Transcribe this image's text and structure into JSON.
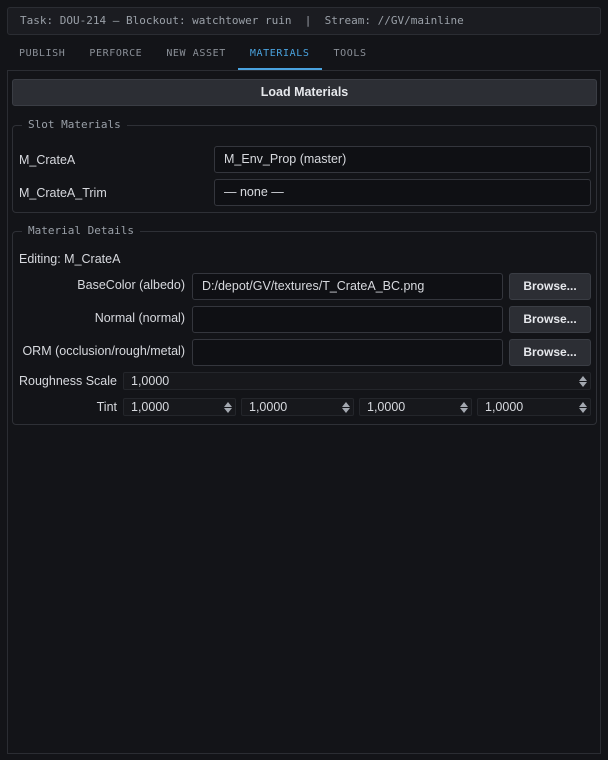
{
  "task_bar": {
    "text": "Task: DOU-214 — Blockout: watchtower ruin  |  Stream: //GV/mainline"
  },
  "tabs": [
    {
      "label": "PUBLISH",
      "active": false
    },
    {
      "label": "PERFORCE",
      "active": false
    },
    {
      "label": "NEW ASSET",
      "active": false
    },
    {
      "label": "MATERIALS",
      "active": true
    },
    {
      "label": "TOOLS",
      "active": false
    }
  ],
  "load_button": "Load Materials",
  "slot_materials": {
    "title": "Slot Materials",
    "rows": [
      {
        "slot": "M_CrateA",
        "value": "M_Env_Prop (master)"
      },
      {
        "slot": "M_CrateA_Trim",
        "value": "— none —"
      }
    ]
  },
  "material_details": {
    "title": "Material Details",
    "editing": "Editing: M_CrateA",
    "textures": [
      {
        "label": "BaseColor (albedo)",
        "value": "D:/depot/GV/textures/T_CrateA_BC.png",
        "button": "Browse..."
      },
      {
        "label": "Normal (normal)",
        "value": "",
        "button": "Browse..."
      },
      {
        "label": "ORM (occlusion/rough/metal)",
        "value": "",
        "button": "Browse..."
      }
    ],
    "roughness": {
      "label": "Roughness Scale",
      "value": "1,0000"
    },
    "tint": {
      "label": "Tint",
      "values": [
        "1,0000",
        "1,0000",
        "1,0000",
        "1,0000"
      ]
    }
  },
  "colors": {
    "accent": "#4aa3df",
    "background": "#131418"
  }
}
